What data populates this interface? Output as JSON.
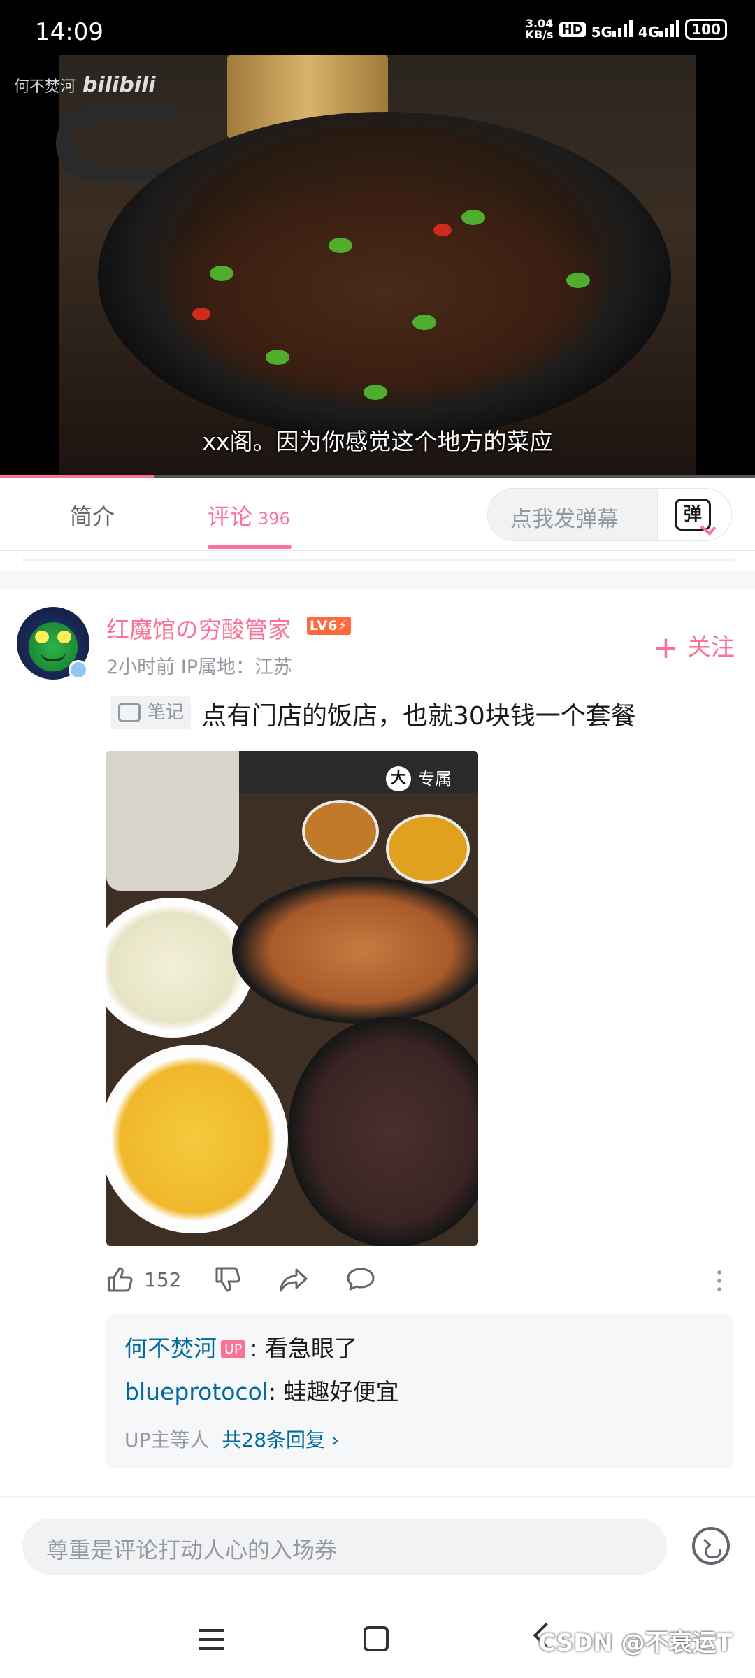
{
  "status_bar": {
    "time": "14:09",
    "speed": "3.04",
    "speed_unit": "KB/s",
    "hd": "HD",
    "net1": "5G",
    "net2": "4G",
    "battery": "100"
  },
  "video": {
    "watermark_user": "何不焚河",
    "watermark_brand": "bilibili",
    "subtitle": "xx阁。因为你感觉这个地方的菜应",
    "progress": 0.205
  },
  "tabs": {
    "intro": "简介",
    "comments": "评论",
    "comment_count": "396",
    "danmu_placeholder": "点我发弹幕",
    "danmu_icon_label": "弹"
  },
  "comment": {
    "username": "红魔馆の穷酸管家",
    "level": "LV6⚡",
    "meta": "2小时前   IP属地：江苏",
    "follow": "关注",
    "note_tag": "笔记",
    "text": "点有门店的饭店，也就30块钱一个套餐",
    "photo_badge": "专属",
    "photo_badge_icon": "大",
    "likes": "152",
    "replies": [
      {
        "name": "何不焚河",
        "up_badge": "UP",
        "text": ": 看急眼了"
      },
      {
        "name": "blueprotocol",
        "text": ": 蛙趣好便宜"
      }
    ],
    "replies_summary": "UP主等人",
    "replies_link": "共28条回复 ›"
  },
  "input": {
    "placeholder": "尊重是评论打动人心的入场券"
  },
  "watermark": "CSDN @不衰运T",
  "colors": {
    "accent": "#fb7299",
    "link": "#00699d",
    "muted": "#9499a0"
  }
}
